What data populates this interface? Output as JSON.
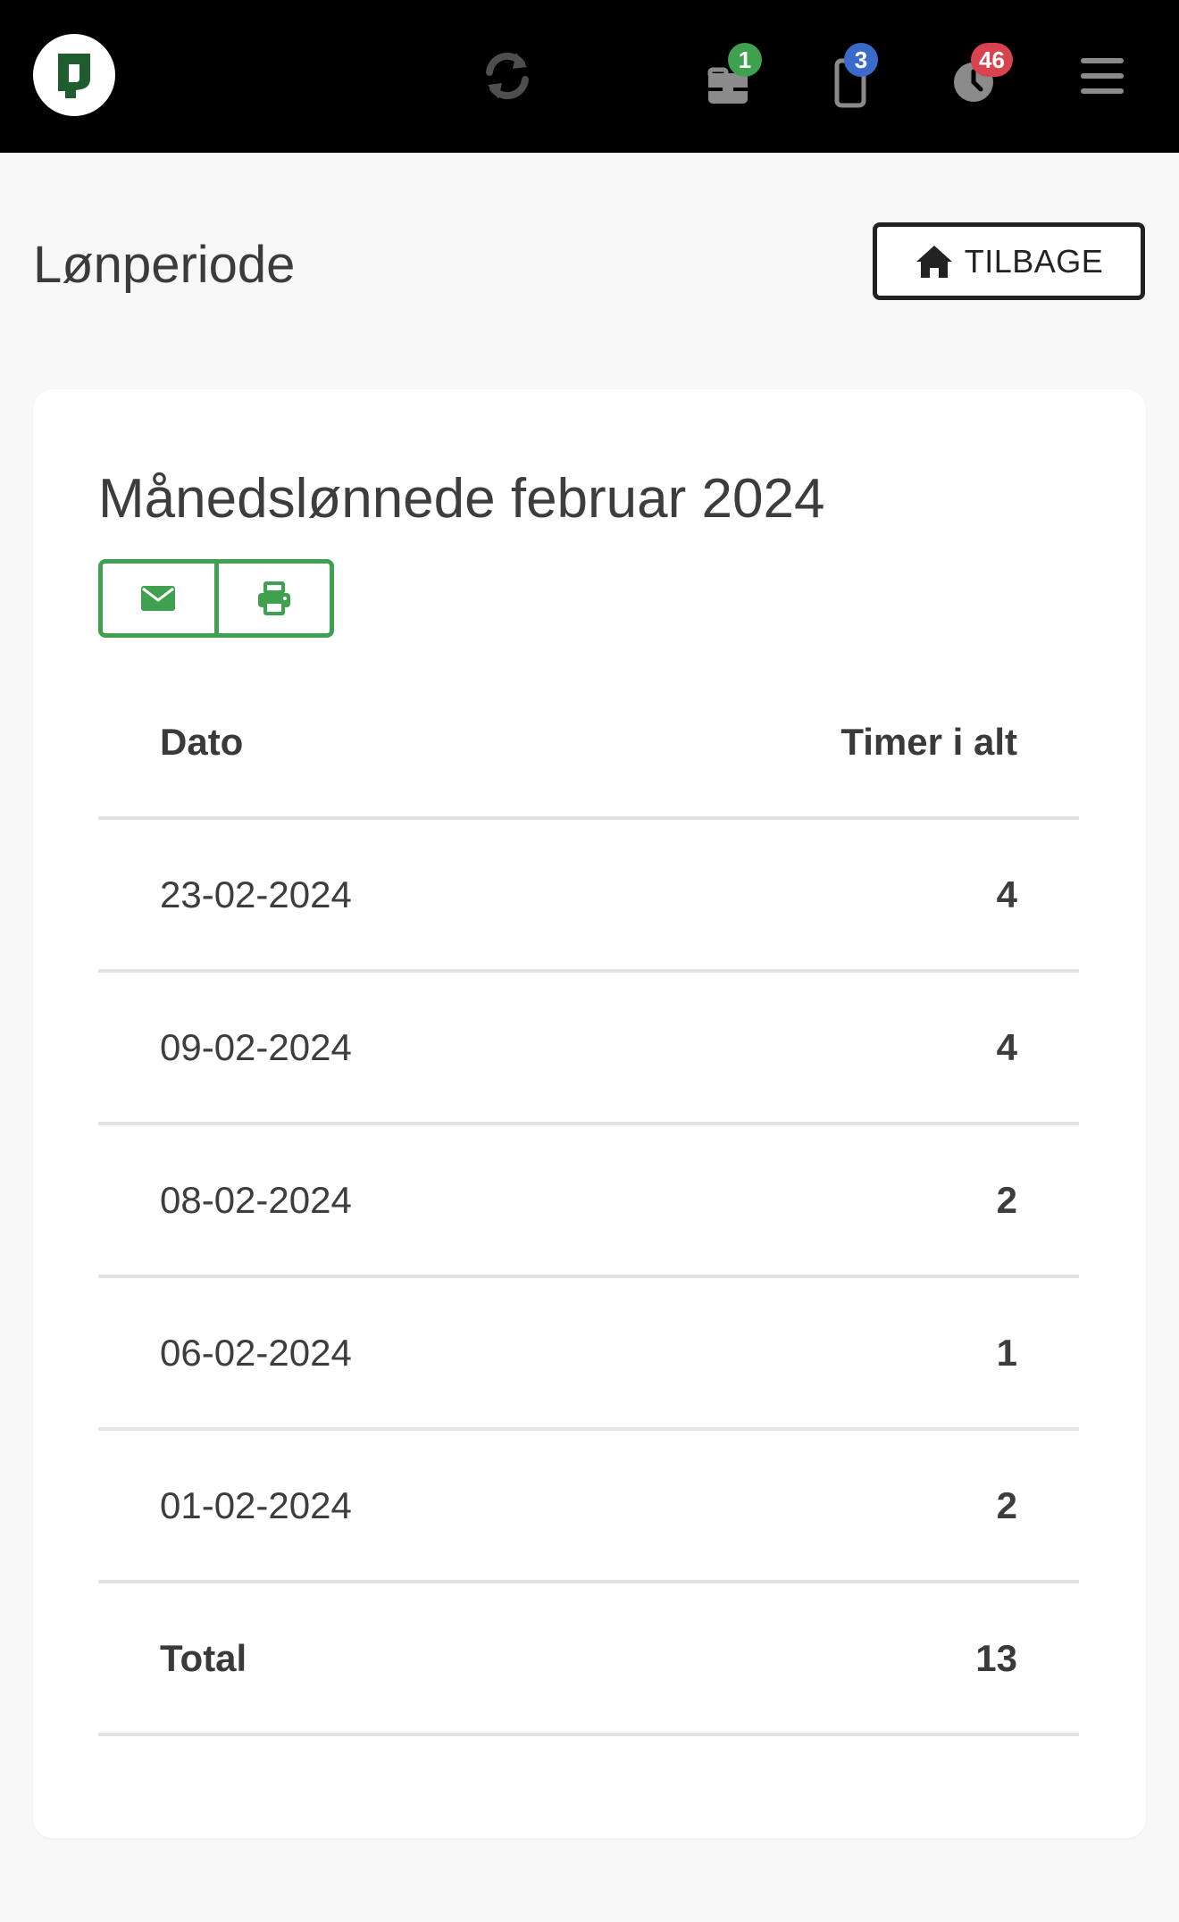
{
  "navbar": {
    "icons": [
      "logo-icon",
      "refresh-icon",
      "briefcase-icon",
      "phone-icon",
      "clock-icon",
      "hamburger-menu-icon"
    ],
    "badges": {
      "briefcase": "1",
      "phone": "3",
      "clock": "46"
    },
    "badge_colors": {
      "briefcase": "#3fa14f",
      "phone": "#3b6bc9",
      "clock": "#d9424f"
    }
  },
  "header": {
    "title": "Lønperiode",
    "back_button_label": "TILBAGE"
  },
  "card": {
    "title": "Månedslønnede februar 2024",
    "actions": [
      "envelope-icon",
      "print-icon"
    ],
    "accent_color": "#3fa14f"
  },
  "table": {
    "headers": [
      "Dato",
      "Timer i alt"
    ],
    "rows": [
      {
        "date": "23-02-2024",
        "hours": "4"
      },
      {
        "date": "09-02-2024",
        "hours": "4"
      },
      {
        "date": "08-02-2024",
        "hours": "2"
      },
      {
        "date": "06-02-2024",
        "hours": "1"
      },
      {
        "date": "01-02-2024",
        "hours": "2"
      }
    ],
    "total_label": "Total",
    "total_value": "13"
  }
}
